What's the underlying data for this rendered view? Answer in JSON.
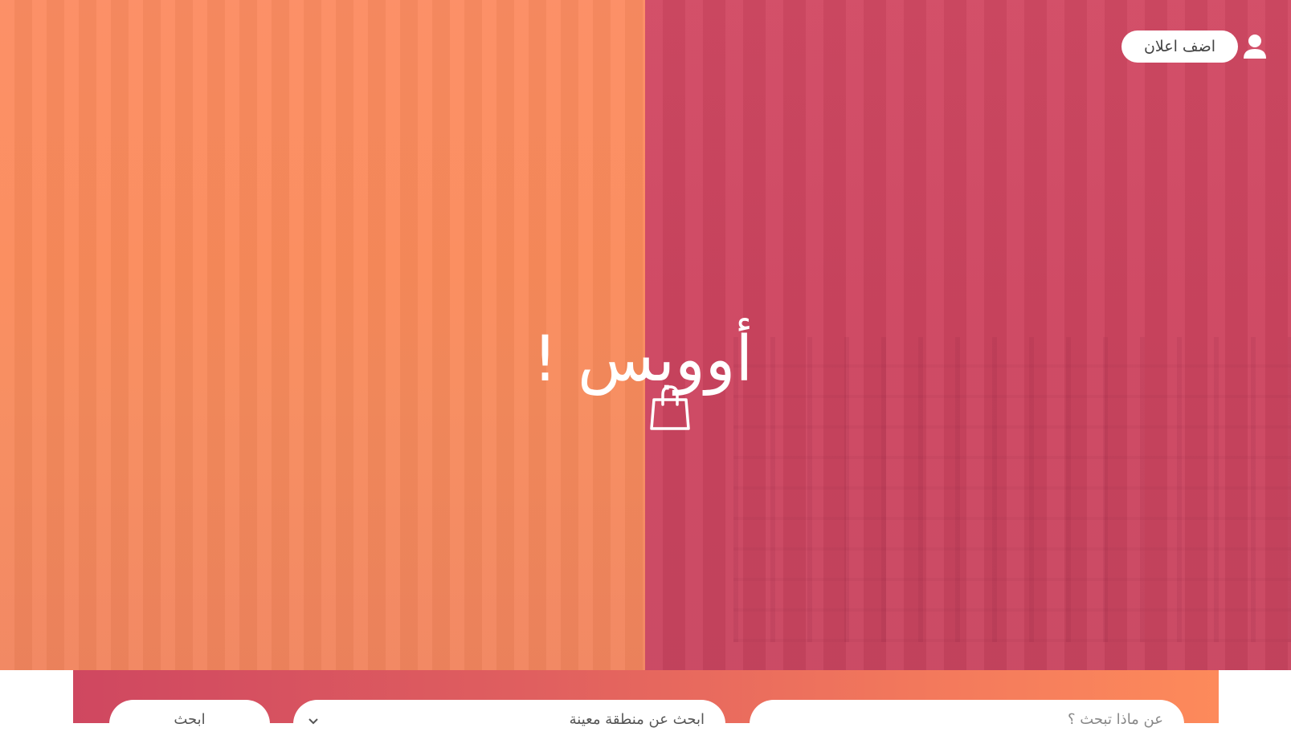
{
  "hero": {
    "title": "أووبس !",
    "bag_icon": "shopping-bag-icon",
    "colors": {
      "left": "#fb8b5b",
      "right": "#ce4560"
    }
  },
  "header": {
    "add_ad_label": "اضف اعلان",
    "user_icon": "user-icon"
  },
  "search": {
    "query_placeholder": "عن ماذا تبحث ؟",
    "region_placeholder": "ابحث عن منطقة معينة",
    "submit_label": "ابحث",
    "bar_gradient": [
      "#cf4760",
      "#fd8a5b"
    ]
  }
}
